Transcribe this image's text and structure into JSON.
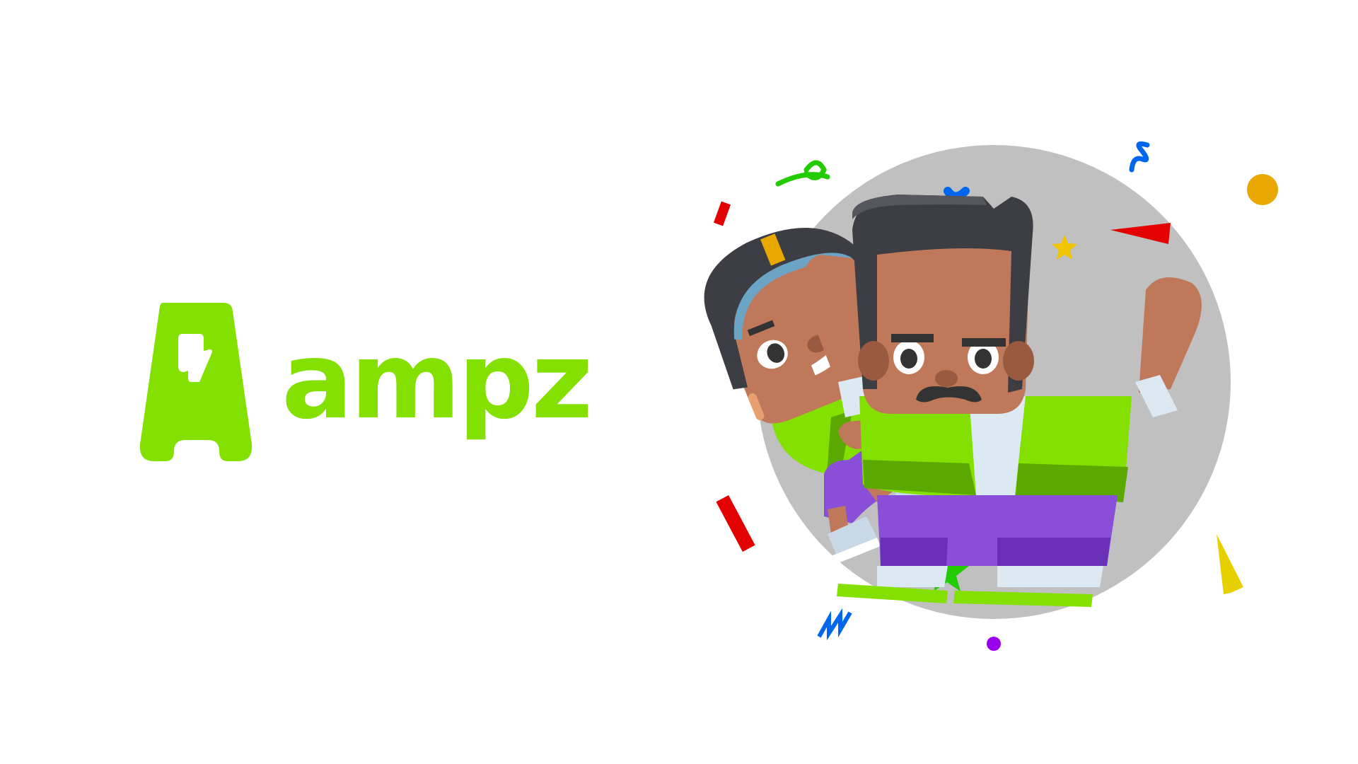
{
  "brand": {
    "name": "ampz",
    "accent_color": "#84e000"
  },
  "illustration": {
    "subject": "celebration-characters",
    "background_circle_color": "#c0c0c0",
    "icons": [
      "logo-mark-icon",
      "lightning-bolt-icon",
      "confetti-icon",
      "star-icon"
    ]
  }
}
